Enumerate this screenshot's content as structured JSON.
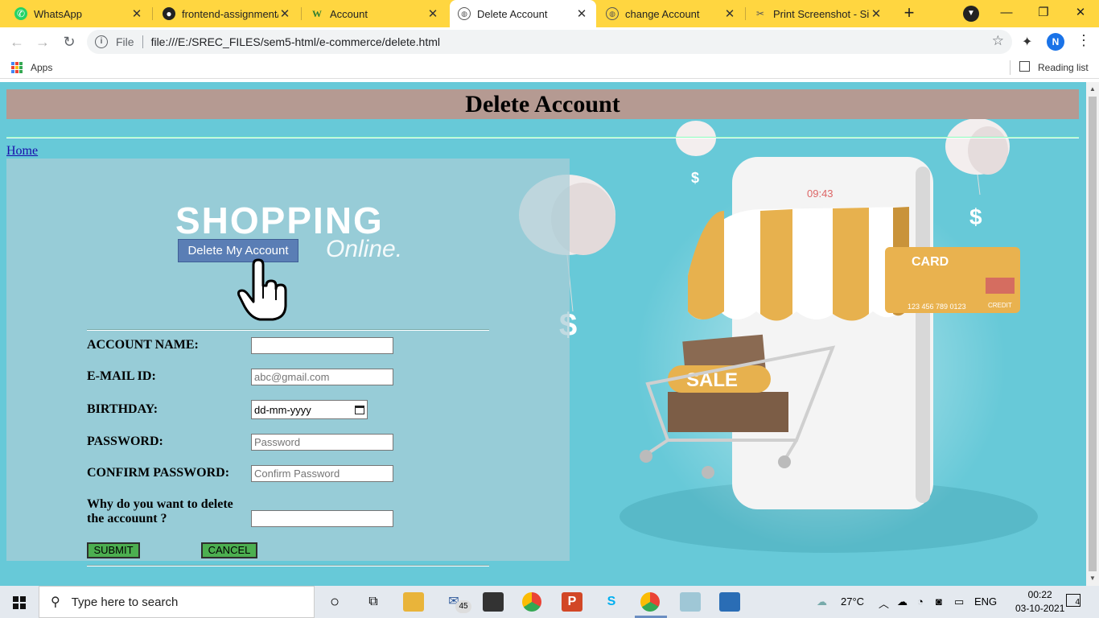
{
  "browser": {
    "tabs": [
      {
        "label": "WhatsApp",
        "icon": "whatsapp-icon",
        "active": false
      },
      {
        "label": "frontend-assignment/",
        "icon": "github-icon",
        "active": false
      },
      {
        "label": "Account",
        "icon": "w-icon",
        "active": false
      },
      {
        "label": "Delete Account",
        "icon": "globe-icon",
        "active": true
      },
      {
        "label": "change Account",
        "icon": "globe-icon",
        "active": false
      },
      {
        "label": "Print Screenshot - Sim",
        "icon": "screenshot-icon",
        "active": false
      }
    ],
    "omnibox": {
      "scheme_label": "File",
      "url": "file:///E:/SREC_FILES/sem5-html/e-commerce/delete.html"
    },
    "profile_initial": "N",
    "bookmarks": {
      "apps_label": "Apps",
      "reading_list_label": "Reading list"
    }
  },
  "page": {
    "title": "Delete Account",
    "home_link": "Home",
    "banner": {
      "shopping_text": "SHOPPING",
      "online_text": "Online.",
      "button_label": "Delete My Account"
    },
    "art": {
      "phone_time": "09:43",
      "card_label": "CARD",
      "card_number": "123 456 789 0123",
      "card_tag": "CREDIT",
      "sale_label": "SALE",
      "dollar": "$"
    },
    "form": {
      "fields": [
        {
          "label": "ACCOUNT NAME:",
          "type": "text",
          "value": "",
          "placeholder": ""
        },
        {
          "label": "E-MAIL ID:",
          "type": "email",
          "value": "",
          "placeholder": "abc@gmail.com"
        },
        {
          "label": "BIRTHDAY:",
          "type": "date",
          "value": "dd-mm-yyyy",
          "placeholder": ""
        },
        {
          "label": "PASSWORD:",
          "type": "password",
          "value": "",
          "placeholder": "Password"
        },
        {
          "label": "CONFIRM PASSWORD:",
          "type": "password",
          "value": "",
          "placeholder": "Confirm Password"
        },
        {
          "label": "Why do you want to delete the accouunt ?",
          "type": "text",
          "value": "",
          "placeholder": ""
        }
      ],
      "submit_label": "SUBMIT",
      "cancel_label": "CANCEL",
      "button_color": "#4caf50"
    }
  },
  "taskbar": {
    "search_placeholder": "Type here to search",
    "mail_badge": "45",
    "weather": "27°C",
    "language": "ENG",
    "time": "00:22",
    "date": "03-10-2021",
    "notification_count": "4"
  },
  "colors": {
    "tabstrip": "#ffd640",
    "page_background": "#67c9d8",
    "header_bar": "#b59a92",
    "delete_button": "#5a7eb5"
  }
}
